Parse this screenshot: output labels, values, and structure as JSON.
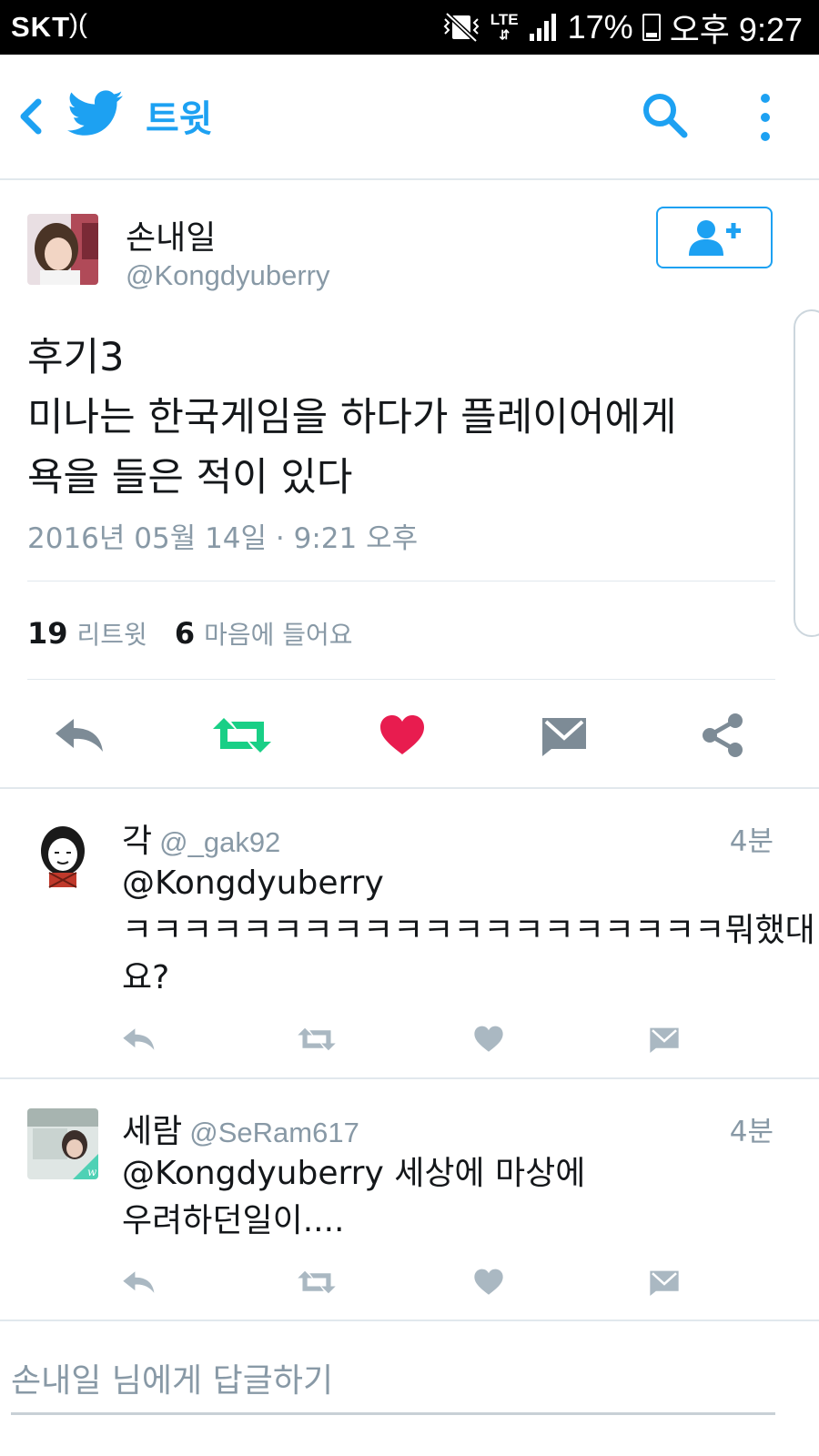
{
  "status_bar": {
    "carrier": "SKT",
    "network": "LTE",
    "battery": "17%",
    "time": "오후 9:27"
  },
  "app_bar": {
    "title": "트윗",
    "icons": [
      "back-arrow-icon",
      "twitter-bird-icon",
      "search-icon",
      "more-vert-icon"
    ]
  },
  "tweet": {
    "author_name": "손내일",
    "author_handle": "@Kongdyuberry",
    "text_lines": [
      "후기3",
      "미나는 한국게임을 하다가 플레이어에게",
      "욕을 들은 적이 있다"
    ],
    "timestamp": "2016년 05월 14일 · 9:21 오후",
    "retweet_count": "19",
    "retweet_label": "리트윗",
    "like_count": "6",
    "like_label": "마음에 들어요"
  },
  "colors": {
    "accent": "#1da1f2",
    "retweet_active": "#19cf86",
    "like_active": "#e81c4f",
    "muted": "#8899a6",
    "icon_gray": "#7d8b96"
  },
  "replies": [
    {
      "name": "각",
      "handle": "@_gak92",
      "time": "4분",
      "body_lines": [
        "@Kongdyuberry",
        "ㅋㅋㅋㅋㅋㅋㅋㅋㅋㅋㅋㅋㅋㅋㅋㅋㅋㅋㅋㅋ뭐했대",
        "요?"
      ]
    },
    {
      "name": "세람",
      "handle": "@SeRam617",
      "time": "4분",
      "body_lines": [
        "@Kongdyuberry 세상에 마상에",
        "우려하던일이...."
      ]
    }
  ],
  "compose": {
    "placeholder": "손내일 님에게 답글하기"
  }
}
